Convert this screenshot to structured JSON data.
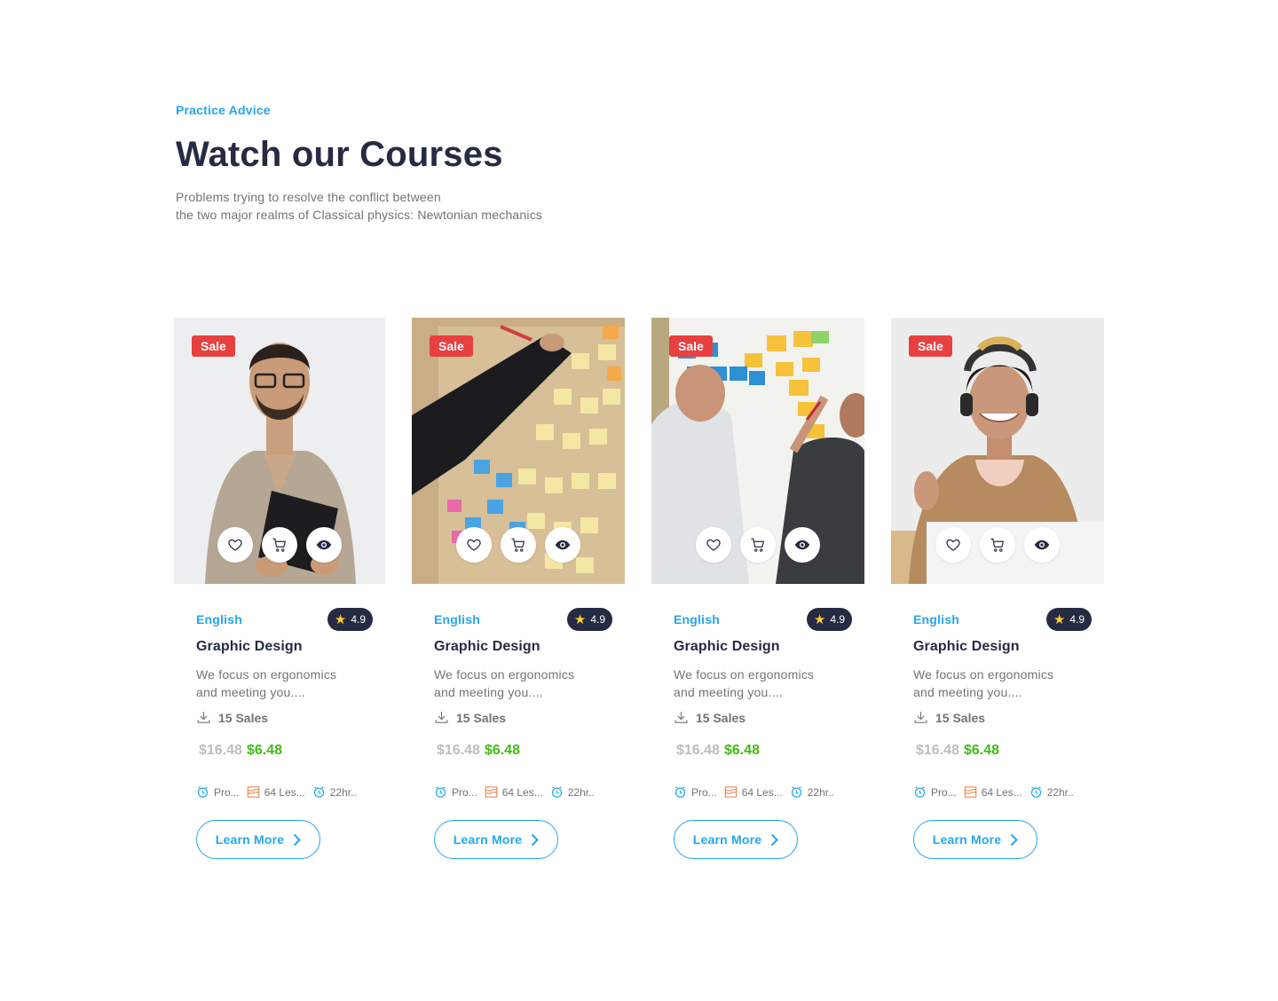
{
  "hero": {
    "eyebrow": "Practice Advice",
    "title": "Watch our Courses",
    "subtitle_line1": "Problems trying to resolve the conflict between",
    "subtitle_line2": "the two major realms of Classical physics: Newtonian mechanics"
  },
  "colors": {
    "accent": "#23a6f0",
    "heading": "#252b42",
    "muted": "#737373",
    "sale": "#e74040",
    "new_price": "#40bb15",
    "old_price": "#bdbdbd",
    "star": "#ffce31"
  },
  "icons": {
    "wishlist": "heart-icon",
    "cart": "cart-icon",
    "preview": "eye-icon",
    "sales": "download-icon",
    "progress": "alarm-clock-icon",
    "lessons": "chart-waves-icon",
    "duration": "alarm-clock-icon",
    "learn_more": "chevron-right-icon",
    "rating": "star-icon"
  },
  "courses": [
    {
      "image": "man-with-notebook-photo",
      "badge": "Sale",
      "language": "English",
      "rating": "4.9",
      "title": "Graphic Design",
      "desc_line1": "We focus on ergonomics",
      "desc_line2": "and meeting you....",
      "sales": "15 Sales",
      "old_price": "$16.48",
      "new_price": "$6.48",
      "meta_progress": "Pro...",
      "meta_lessons": "64 Les...",
      "meta_duration": "22hr..",
      "cta": "Learn More"
    },
    {
      "image": "sticky-notes-wall-photo",
      "badge": "Sale",
      "language": "English",
      "rating": "4.9",
      "title": "Graphic Design",
      "desc_line1": "We focus on ergonomics",
      "desc_line2": "and meeting you....",
      "sales": "15 Sales",
      "old_price": "$16.48",
      "new_price": "$6.48",
      "meta_progress": "Pro...",
      "meta_lessons": "64 Les...",
      "meta_duration": "22hr..",
      "cta": "Learn More"
    },
    {
      "image": "whiteboard-planning-photo",
      "badge": "Sale",
      "language": "English",
      "rating": "4.9",
      "title": "Graphic Design",
      "desc_line1": "We focus on ergonomics",
      "desc_line2": "and meeting you....",
      "sales": "15 Sales",
      "old_price": "$16.48",
      "new_price": "$6.48",
      "meta_progress": "Pro...",
      "meta_lessons": "64 Les...",
      "meta_duration": "22hr..",
      "cta": "Learn More"
    },
    {
      "image": "woman-with-headphones-photo",
      "badge": "Sale",
      "language": "English",
      "rating": "4.9",
      "title": "Graphic Design",
      "desc_line1": "We focus on ergonomics",
      "desc_line2": "and meeting you....",
      "sales": "15 Sales",
      "old_price": "$16.48",
      "new_price": "$6.48",
      "meta_progress": "Pro...",
      "meta_lessons": "64 Les...",
      "meta_duration": "22hr..",
      "cta": "Learn More"
    }
  ]
}
